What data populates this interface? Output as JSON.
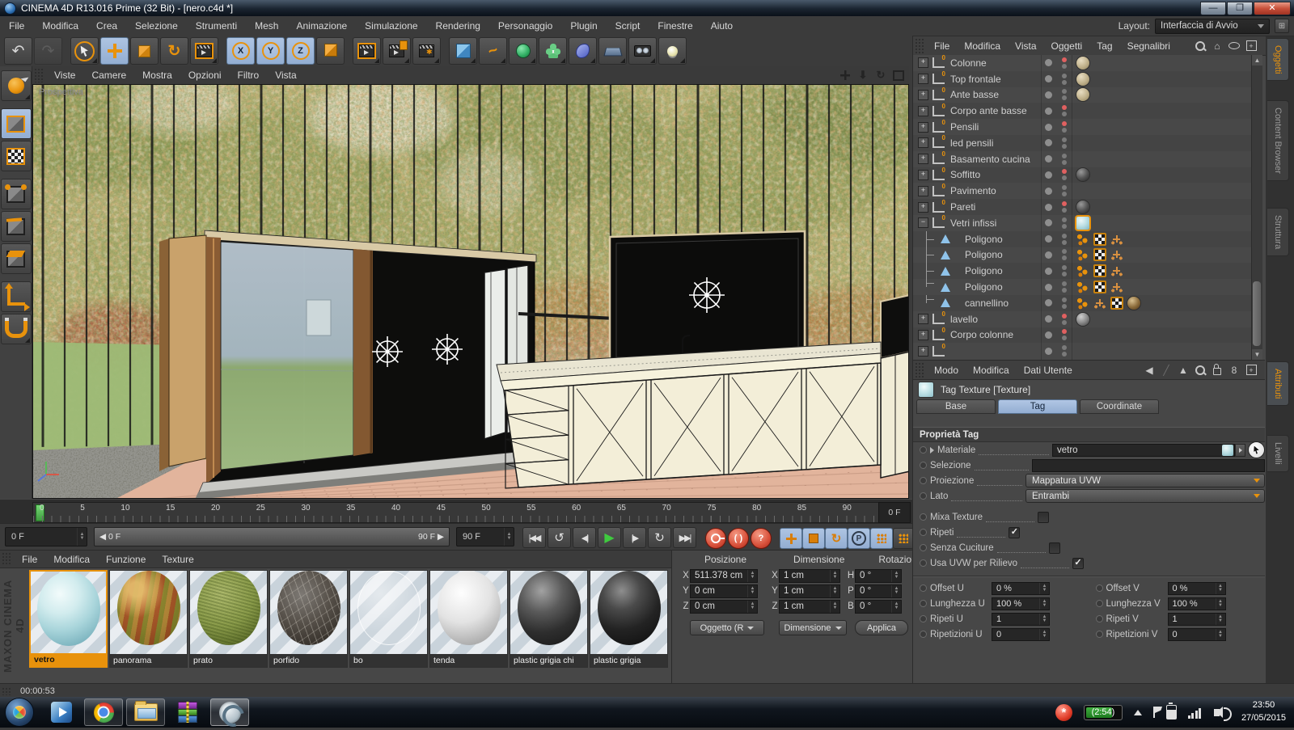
{
  "colors": {
    "accent": "#E8920C",
    "tab_blue": "#9DB8DC",
    "red_dot": "#E06060",
    "play_green": "#3FCA3F"
  },
  "window": {
    "title": "CINEMA 4D R13.016 Prime (32 Bit) - [nero.c4d *]"
  },
  "menubar": {
    "items": [
      "File",
      "Modifica",
      "Crea",
      "Selezione",
      "Strumenti",
      "Mesh",
      "Animazione",
      "Simulazione",
      "Rendering",
      "Personaggio",
      "Plugin",
      "Script",
      "Finestre",
      "Aiuto"
    ],
    "layout_label": "Layout:",
    "layout_value": "Interfaccia di Avvio"
  },
  "toolbar": {
    "axis_buttons": [
      "X",
      "Y",
      "Z"
    ]
  },
  "viewport": {
    "menu": [
      "Viste",
      "Camere",
      "Mostra",
      "Opzioni",
      "Filtro",
      "Vista"
    ],
    "view_label": "Prospettiva",
    "nav_icons": [
      "pan-icon",
      "dolly-icon",
      "rotate-icon",
      "toggle-view-icon"
    ]
  },
  "timeline": {
    "ticks": [
      "0",
      "5",
      "10",
      "15",
      "20",
      "25",
      "30",
      "35",
      "40",
      "45",
      "50",
      "55",
      "60",
      "65",
      "70",
      "75",
      "80",
      "85",
      "90"
    ],
    "frame_box": "0 F"
  },
  "transport": {
    "current": "0 F",
    "range_start": "0 F",
    "range_end": "90 F",
    "end": "90 F",
    "icons": [
      "go-start-icon",
      "play-backwards-icon",
      "step-back-icon",
      "play-icon",
      "step-forward-icon",
      "loop-icon",
      "go-end-icon"
    ],
    "record_icons": [
      "record-key-icon",
      "autokey-icon",
      "help-icon"
    ],
    "track_icons": [
      "record-position-icon",
      "record-scale-icon",
      "record-rotation-icon",
      "record-parameter-icon",
      "record-pla-icon"
    ]
  },
  "object_manager": {
    "menu": [
      "File",
      "Modifica",
      "Vista",
      "Oggetti",
      "Tag",
      "Segnalibri"
    ],
    "icons": [
      "search-icon",
      "home-icon",
      "filter-icon",
      "add-panel-icon"
    ],
    "objects": [
      {
        "name": "Colonne",
        "kind": "null",
        "expand": "plus",
        "red": true,
        "mat": "beige"
      },
      {
        "name": "Top frontale",
        "kind": "null",
        "expand": "plus",
        "red": false,
        "mat": "beige"
      },
      {
        "name": "Ante basse",
        "kind": "null",
        "expand": "plus",
        "red": false,
        "mat": "beige"
      },
      {
        "name": "Corpo ante basse",
        "kind": "null",
        "expand": "plus",
        "red": true,
        "mat": null
      },
      {
        "name": "Pensili",
        "kind": "null",
        "expand": "plus",
        "red": true,
        "mat": null
      },
      {
        "name": "led pensili",
        "kind": "null",
        "expand": "plus",
        "red": false,
        "mat": null
      },
      {
        "name": "Basamento cucina",
        "kind": "null",
        "expand": "plus",
        "red": false,
        "mat": null
      },
      {
        "name": "Soffitto",
        "kind": "null",
        "expand": "plus",
        "red": true,
        "mat": "dark"
      },
      {
        "name": "Pavimento",
        "kind": "null",
        "expand": "plus",
        "red": false,
        "mat": null
      },
      {
        "name": "Pareti",
        "kind": "null",
        "expand": "plus",
        "red": true,
        "mat": "dark"
      },
      {
        "name": "Vetri infissi",
        "kind": "null",
        "expand": "minus",
        "red": false,
        "mat": "glass",
        "sel": true
      },
      {
        "name": "Poligono",
        "kind": "poly",
        "child": true,
        "tags": [
          "dots",
          "checker",
          "axis"
        ]
      },
      {
        "name": "Poligono",
        "kind": "poly",
        "child": true,
        "tags": [
          "dots",
          "checker",
          "axis"
        ]
      },
      {
        "name": "Poligono",
        "kind": "poly",
        "child": true,
        "tags": [
          "dots",
          "checker",
          "axis"
        ]
      },
      {
        "name": "Poligono",
        "kind": "poly",
        "child": true,
        "last": true,
        "tags": [
          "dots",
          "checker",
          "axis"
        ]
      },
      {
        "name": "cannellino",
        "kind": "poly",
        "child": true,
        "last": true,
        "tags": [
          "dots",
          "axis",
          "checker",
          "brown"
        ]
      },
      {
        "name": "lavello",
        "kind": "null",
        "expand": "plus",
        "red": true,
        "mat": "grey"
      },
      {
        "name": "Corpo colonne",
        "kind": "null",
        "expand": "plus",
        "red": true,
        "mat": null
      },
      {
        "name": "",
        "kind": "null",
        "expand": "plus",
        "red": false,
        "mat": null
      }
    ]
  },
  "attributes": {
    "menu": [
      "Modo",
      "Modifica",
      "Dati Utente"
    ],
    "icons": [
      "back-icon",
      "forward-icon",
      "up-icon",
      "search-icon",
      "lock-icon",
      "history-icon"
    ],
    "title": "Tag Texture [Texture]",
    "tabs": [
      "Base",
      "Tag",
      "Coordinate"
    ],
    "active_tab": "Tag",
    "section": "Proprietà Tag",
    "materiale_label": "Materiale",
    "materiale_value": "vetro",
    "selezione_label": "Selezione",
    "selezione_value": "",
    "proiezione_label": "Proiezione",
    "proiezione_value": "Mappatura UVW",
    "lato_label": "Lato",
    "lato_value": "Entrambi",
    "checks": [
      {
        "label": "Mixa Texture",
        "checked": false
      },
      {
        "label": "Ripeti",
        "checked": true
      },
      {
        "label": "Senza Cuciture",
        "checked": false
      },
      {
        "label": "Usa UVW per Rilievo",
        "checked": true
      }
    ],
    "spinners": [
      {
        "label": "Offset U",
        "value": "0 %"
      },
      {
        "label": "Offset V",
        "value": "0 %"
      },
      {
        "label": "Lunghezza U",
        "value": "100 %"
      },
      {
        "label": "Lunghezza V",
        "value": "100 %"
      },
      {
        "label": "Ripeti U",
        "value": "1"
      },
      {
        "label": "Ripeti V",
        "value": "1"
      },
      {
        "label": "Ripetizioni U",
        "value": "0"
      },
      {
        "label": "Ripetizioni V",
        "value": "0"
      }
    ]
  },
  "materials_panel": {
    "menu": [
      "File",
      "Modifica",
      "Funzione",
      "Texture"
    ],
    "brand": "MAXON CINEMA 4D",
    "materials": [
      {
        "name": "vetro",
        "type": "glass",
        "selected": true
      },
      {
        "name": "panorama",
        "type": "panorama",
        "selected": false
      },
      {
        "name": "prato",
        "type": "grass",
        "selected": false
      },
      {
        "name": "porfido",
        "type": "stone",
        "selected": false
      },
      {
        "name": "bo",
        "type": "clear",
        "selected": false
      },
      {
        "name": "tenda",
        "type": "white",
        "selected": false
      },
      {
        "name": "plastic grigia chi",
        "type": "dark1",
        "selected": false
      },
      {
        "name": "plastic grigia",
        "type": "dark2",
        "selected": false
      }
    ]
  },
  "coordinates": {
    "headers": [
      "Posizione",
      "Dimensione",
      "Rotazione"
    ],
    "position": [
      {
        "axis": "X",
        "value": "511.378 cm"
      },
      {
        "axis": "Y",
        "value": "0 cm"
      },
      {
        "axis": "Z",
        "value": "0 cm"
      }
    ],
    "dimension": [
      {
        "axis": "X",
        "value": "1 cm"
      },
      {
        "axis": "Y",
        "value": "1 cm"
      },
      {
        "axis": "Z",
        "value": "1 cm"
      }
    ],
    "rotation": [
      {
        "axis": "H",
        "value": "0 °"
      },
      {
        "axis": "P",
        "value": "0 °"
      },
      {
        "axis": "B",
        "value": "0 °"
      }
    ],
    "buttons": [
      "Oggetto (R",
      "Dimensione",
      "Applica"
    ]
  },
  "side_tabs": {
    "top": [
      {
        "label": "Oggetti",
        "active": true
      },
      {
        "label": "Content Browser",
        "active": false
      },
      {
        "label": "Struttura",
        "active": false
      }
    ],
    "bottom": [
      {
        "label": "Attributi",
        "active": true
      },
      {
        "label": "Livelli",
        "active": false
      }
    ]
  },
  "status": {
    "render_time": "00:00:53"
  },
  "taskbar": {
    "battery_time": "(2:54)",
    "clock": "23:50",
    "date": "27/05/2015"
  }
}
